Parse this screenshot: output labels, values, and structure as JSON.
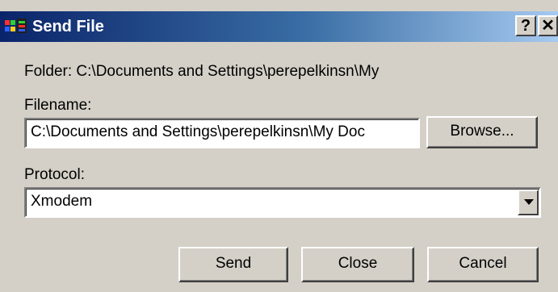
{
  "window": {
    "title": "Send File",
    "help_button": "?",
    "close_button": "✕"
  },
  "folder": {
    "label": "Folder:",
    "path": "C:\\Documents and Settings\\perepelkinsn\\My"
  },
  "filename": {
    "label": "Filename:",
    "value": "C:\\Documents and Settings\\perepelkinsn\\My Doc"
  },
  "browse_label": "Browse...",
  "protocol": {
    "label": "Protocol:",
    "selected": "Xmodem"
  },
  "actions": {
    "send_label": "Send",
    "close_label": "Close",
    "cancel_label": "Cancel"
  },
  "colors": {
    "titlebar_start": "#0a246a",
    "titlebar_end": "#a6caf0",
    "dialog_face": "#d4d0c8"
  }
}
